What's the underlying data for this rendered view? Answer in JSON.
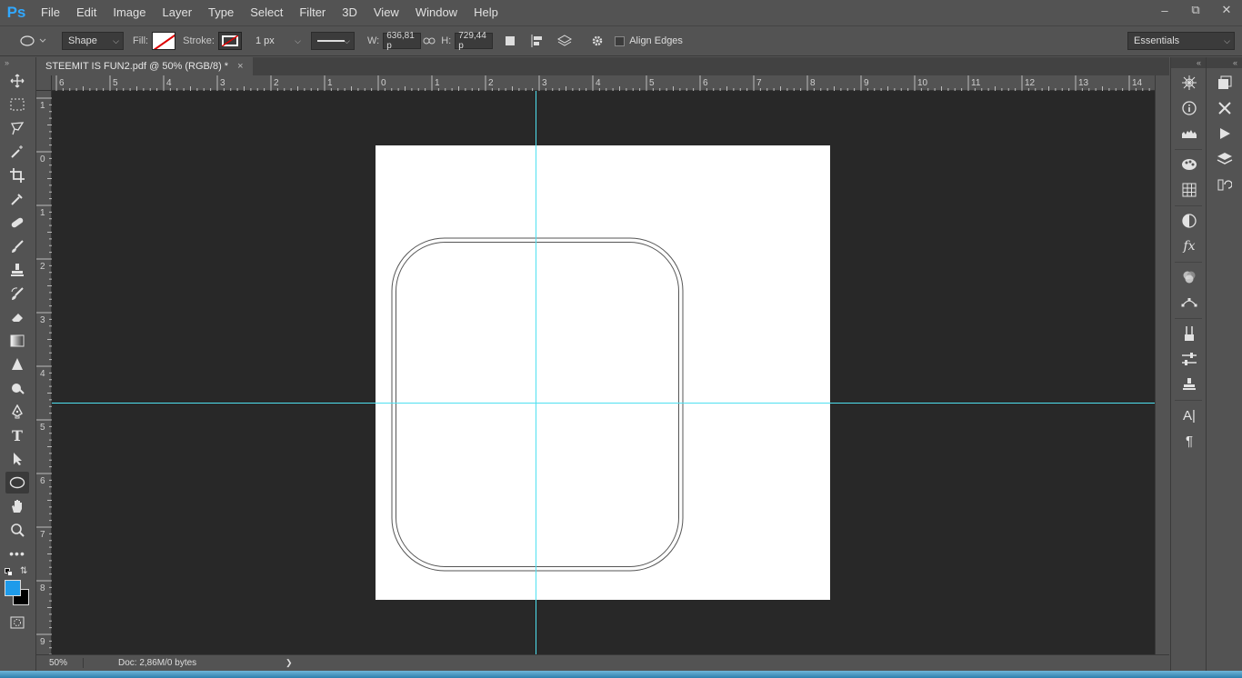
{
  "app": {
    "logo": "Ps"
  },
  "menu": [
    "File",
    "Edit",
    "Image",
    "Layer",
    "Type",
    "Select",
    "Filter",
    "3D",
    "View",
    "Window",
    "Help"
  ],
  "window_controls": {
    "minimize": "–",
    "restore": "⧉",
    "close": "✕"
  },
  "options": {
    "tool_mode": "Shape",
    "fill_label": "Fill:",
    "stroke_label": "Stroke:",
    "stroke_width": "1 px",
    "w_label": "W:",
    "w_value": "636,81 p",
    "h_label": "H:",
    "h_value": "729,44 p",
    "align_edges": "Align Edges",
    "workspace": "Essentials"
  },
  "document": {
    "tab_title": "STEEMIT IS FUN2.pdf @ 50% (RGB/8) *",
    "close": "×"
  },
  "rulers": {
    "top": [
      "6",
      "5",
      "4",
      "3",
      "2",
      "1",
      "0",
      "1",
      "2",
      "3",
      "4",
      "5",
      "6",
      "7",
      "8",
      "9",
      "10",
      "11",
      "12",
      "13",
      "14"
    ],
    "left": [
      "1",
      "0",
      "1",
      "2",
      "3",
      "4",
      "5",
      "6",
      "7",
      "8",
      "9"
    ]
  },
  "status": {
    "zoom": "50%",
    "doc_info": "Doc: 2,86M/0 bytes",
    "arrow": "❯"
  },
  "colors": {
    "foreground": "#1e9bea",
    "background": "#000000",
    "guide": "#4fe0f0",
    "canvas_bg": "#282828"
  }
}
